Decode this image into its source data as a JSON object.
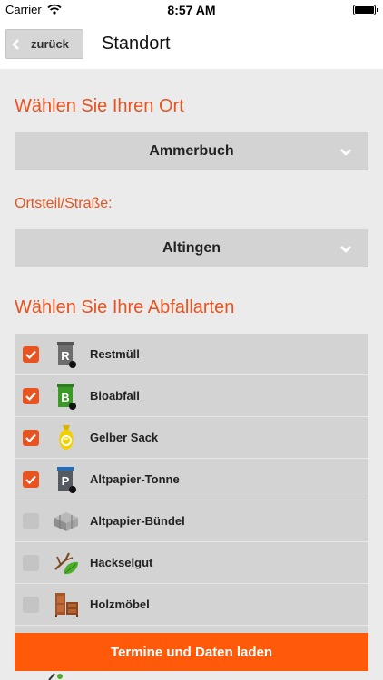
{
  "status_bar": {
    "carrier": "Carrier",
    "time": "8:57 AM"
  },
  "nav": {
    "back_label": "zurück",
    "title": "Standort"
  },
  "location": {
    "heading": "Wählen Sie Ihren Ort",
    "place_value": "Ammerbuch",
    "district_label": "Ortsteil/Straße:",
    "district_value": "Altingen"
  },
  "waste_types": {
    "heading": "Wählen Sie Ihre Abfallarten",
    "items": [
      {
        "label": "Restmüll",
        "checked": true,
        "icon": "restmuell-bin-icon"
      },
      {
        "label": "Bioabfall",
        "checked": true,
        "icon": "bio-bin-icon"
      },
      {
        "label": "Gelber Sack",
        "checked": true,
        "icon": "yellow-sack-icon"
      },
      {
        "label": "Altpapier-Tonne",
        "checked": true,
        "icon": "paper-bin-icon"
      },
      {
        "label": "Altpapier-Bündel",
        "checked": false,
        "icon": "paper-bundle-icon"
      },
      {
        "label": "Häckselgut",
        "checked": false,
        "icon": "branch-leaf-icon"
      },
      {
        "label": "Holzmöbel",
        "checked": false,
        "icon": "wooden-furniture-icon"
      }
    ]
  },
  "actions": {
    "load_label": "Termine und Daten laden"
  },
  "colors": {
    "accent": "#e8531f",
    "button": "#ff5a0a",
    "row_bg": "#d3d3d3",
    "page_bg": "#ebebeb"
  }
}
